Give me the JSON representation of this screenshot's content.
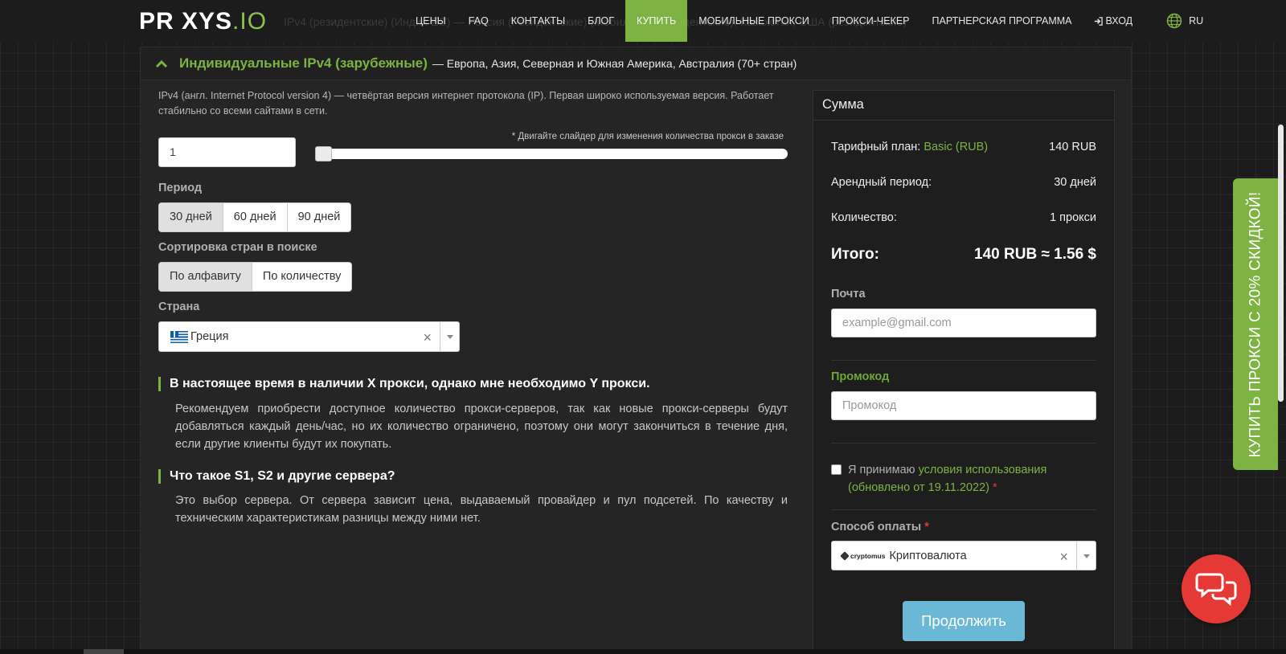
{
  "navbar": {
    "logo_main": "PR XYS",
    "logo_suffix": ".IO",
    "ghost_text": "IPv4 (резидентские) (Индия ЕС) — Россия (Резидентские) (Мобильные/Резидентские), Казахстан, США (резидентские)",
    "items": [
      {
        "label": "ЦЕНЫ"
      },
      {
        "label": "FAQ"
      },
      {
        "label": "КОНТАКТЫ"
      },
      {
        "label": "БЛОГ"
      },
      {
        "label": "КУПИТЬ",
        "active": true
      },
      {
        "label": "МОБИЛЬНЫЕ ПРОКСИ"
      },
      {
        "label": "ПРОКСИ-ЧЕКЕР"
      },
      {
        "label": "ПАРТНЕРСКАЯ ПРОГРАММА"
      }
    ],
    "login_label": "ВХОД",
    "lang_label": "RU"
  },
  "accordion": {
    "title": "Индивидуальные IPv4 (зарубежные)",
    "subtitle": "— Европа, Азия, Северная и Южная Америка, Австралия (70+ стран)"
  },
  "form": {
    "description": "IPv4 (англ. Internet Protocol version 4) — четвёртая версия интернет протокола (IP). Первая широко используемая версия. Работает стабильно со всеми сайтами в сети.",
    "quantity_value": "1",
    "slider_hint": "* Двигайте слайдер для изменения количества прокси в заказе",
    "slider_value": 1,
    "period_label": "Период",
    "period_options": [
      "30 дней",
      "60 дней",
      "90 дней"
    ],
    "sort_label": "Сортировка стран в поиске",
    "sort_options": [
      "По алфавиту",
      "По количеству"
    ],
    "country_label": "Страна",
    "country_value": "Греция",
    "clear_symbol": "×"
  },
  "faq": [
    {
      "question": "В настоящее время в наличии X прокси, однако мне необходимо Y прокси.",
      "answer": "Рекомендуем приобрести доступное количество прокси-серверов, так как новые прокси-серверы будут добавляться каждый день/час, но их количество ограничено, поэтому они могут закончиться в течение дня, если другие клиенты будут их покупать."
    },
    {
      "question": "Что такое S1, S2 и другие сервера?",
      "answer": "Это выбор сервера. От сервера зависит цена, выдаваемый провайдер и пул подсетей. По качеству и техническим характеристикам разницы между ними нет."
    }
  ],
  "summary": {
    "title": "Сумма",
    "plan_label": "Тарифный план:",
    "plan_name": "Basic (RUB)",
    "plan_price": "140 RUB",
    "period_label": "Арендный период:",
    "period_value": "30 дней",
    "quantity_label": "Количество:",
    "quantity_value": "1 прокси",
    "total_label": "Итого:",
    "total_value": "140 RUB ≈ 1.56 $",
    "email_label": "Почта",
    "email_placeholder": "example@gmail.com",
    "promo_label": "Промокод",
    "promo_placeholder": "Промокод",
    "terms_prefix": "Я принимаю",
    "terms_link": "условия использования (обновлено от 19.11.2022)",
    "required_mark": "*",
    "payment_label": "Способ оплаты",
    "payment_logo": "cryptomus",
    "payment_value": "Криптовалюта",
    "continue_label": "Продолжить"
  },
  "side_tab": {
    "label": "КУПИТЬ ПРОКСИ С 20% СКИДКОЙ!"
  },
  "colors": {
    "accent": "#7cb342",
    "button": "#6bb8d6",
    "chat": "#e53935",
    "required": "#e53935"
  },
  "icons": [
    "chevron-up-icon",
    "login-icon",
    "globe-icon",
    "greece-flag-icon",
    "cryptomus-icon",
    "chat-icon",
    "chevron-down-icon"
  ]
}
